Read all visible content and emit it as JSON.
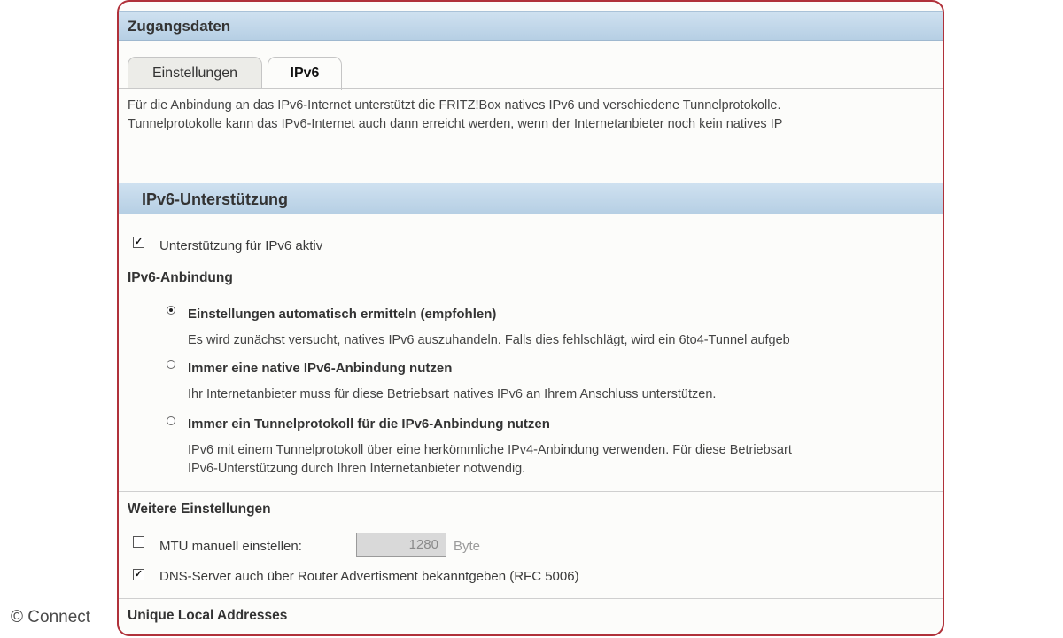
{
  "header": {
    "title": "Zugangsdaten"
  },
  "tabs": [
    {
      "label": "Einstellungen"
    },
    {
      "label": "IPv6",
      "active": true
    }
  ],
  "intro": {
    "line1": "Für die Anbindung an das IPv6-Internet unterstützt die FRITZ!Box natives IPv6 und verschiedene Tunnelprotokolle.",
    "line2": "Tunnelprotokolle kann das IPv6-Internet auch dann erreicht werden, wenn der Internetanbieter noch kein natives IP"
  },
  "support": {
    "title": "IPv6-Unterstützung",
    "checkbox_label": "Unterstützung für IPv6 aktiv",
    "checked": true
  },
  "anbindung": {
    "heading": "IPv6-Anbindung",
    "options": [
      {
        "label": "Einstellungen automatisch ermitteln (empfohlen)",
        "selected": true,
        "desc1": "Es wird zunächst versucht, natives IPv6 auszuhandeln. Falls dies fehlschlägt, wird ein 6to4-Tunnel aufgeb",
        "desc2": ""
      },
      {
        "label": "Immer eine native IPv6-Anbindung nutzen",
        "selected": false,
        "desc1": "Ihr Internetanbieter muss für diese Betriebsart natives IPv6 an Ihrem Anschluss unterstützen.",
        "desc2": ""
      },
      {
        "label": "Immer ein Tunnelprotokoll für die IPv6-Anbindung nutzen",
        "selected": false,
        "desc1": "IPv6 mit einem Tunnelprotokoll über eine herkömmliche IPv4-Anbindung verwenden. Für diese Betriebsart",
        "desc2": "IPv6-Unterstützung durch Ihren Internetanbieter notwendig."
      }
    ]
  },
  "weitere": {
    "heading": "Weitere Einstellungen",
    "mtu_label": "MTU manuell einstellen:",
    "mtu_checked": false,
    "mtu_value": "1280",
    "mtu_unit": "Byte",
    "dns_label": "DNS-Server auch über Router Advertisment bekanntgeben (RFC 5006)",
    "dns_checked": true
  },
  "ula": {
    "heading": "Unique Local Addresses"
  },
  "watermark": "© Connect",
  "check_glyph": "✓"
}
